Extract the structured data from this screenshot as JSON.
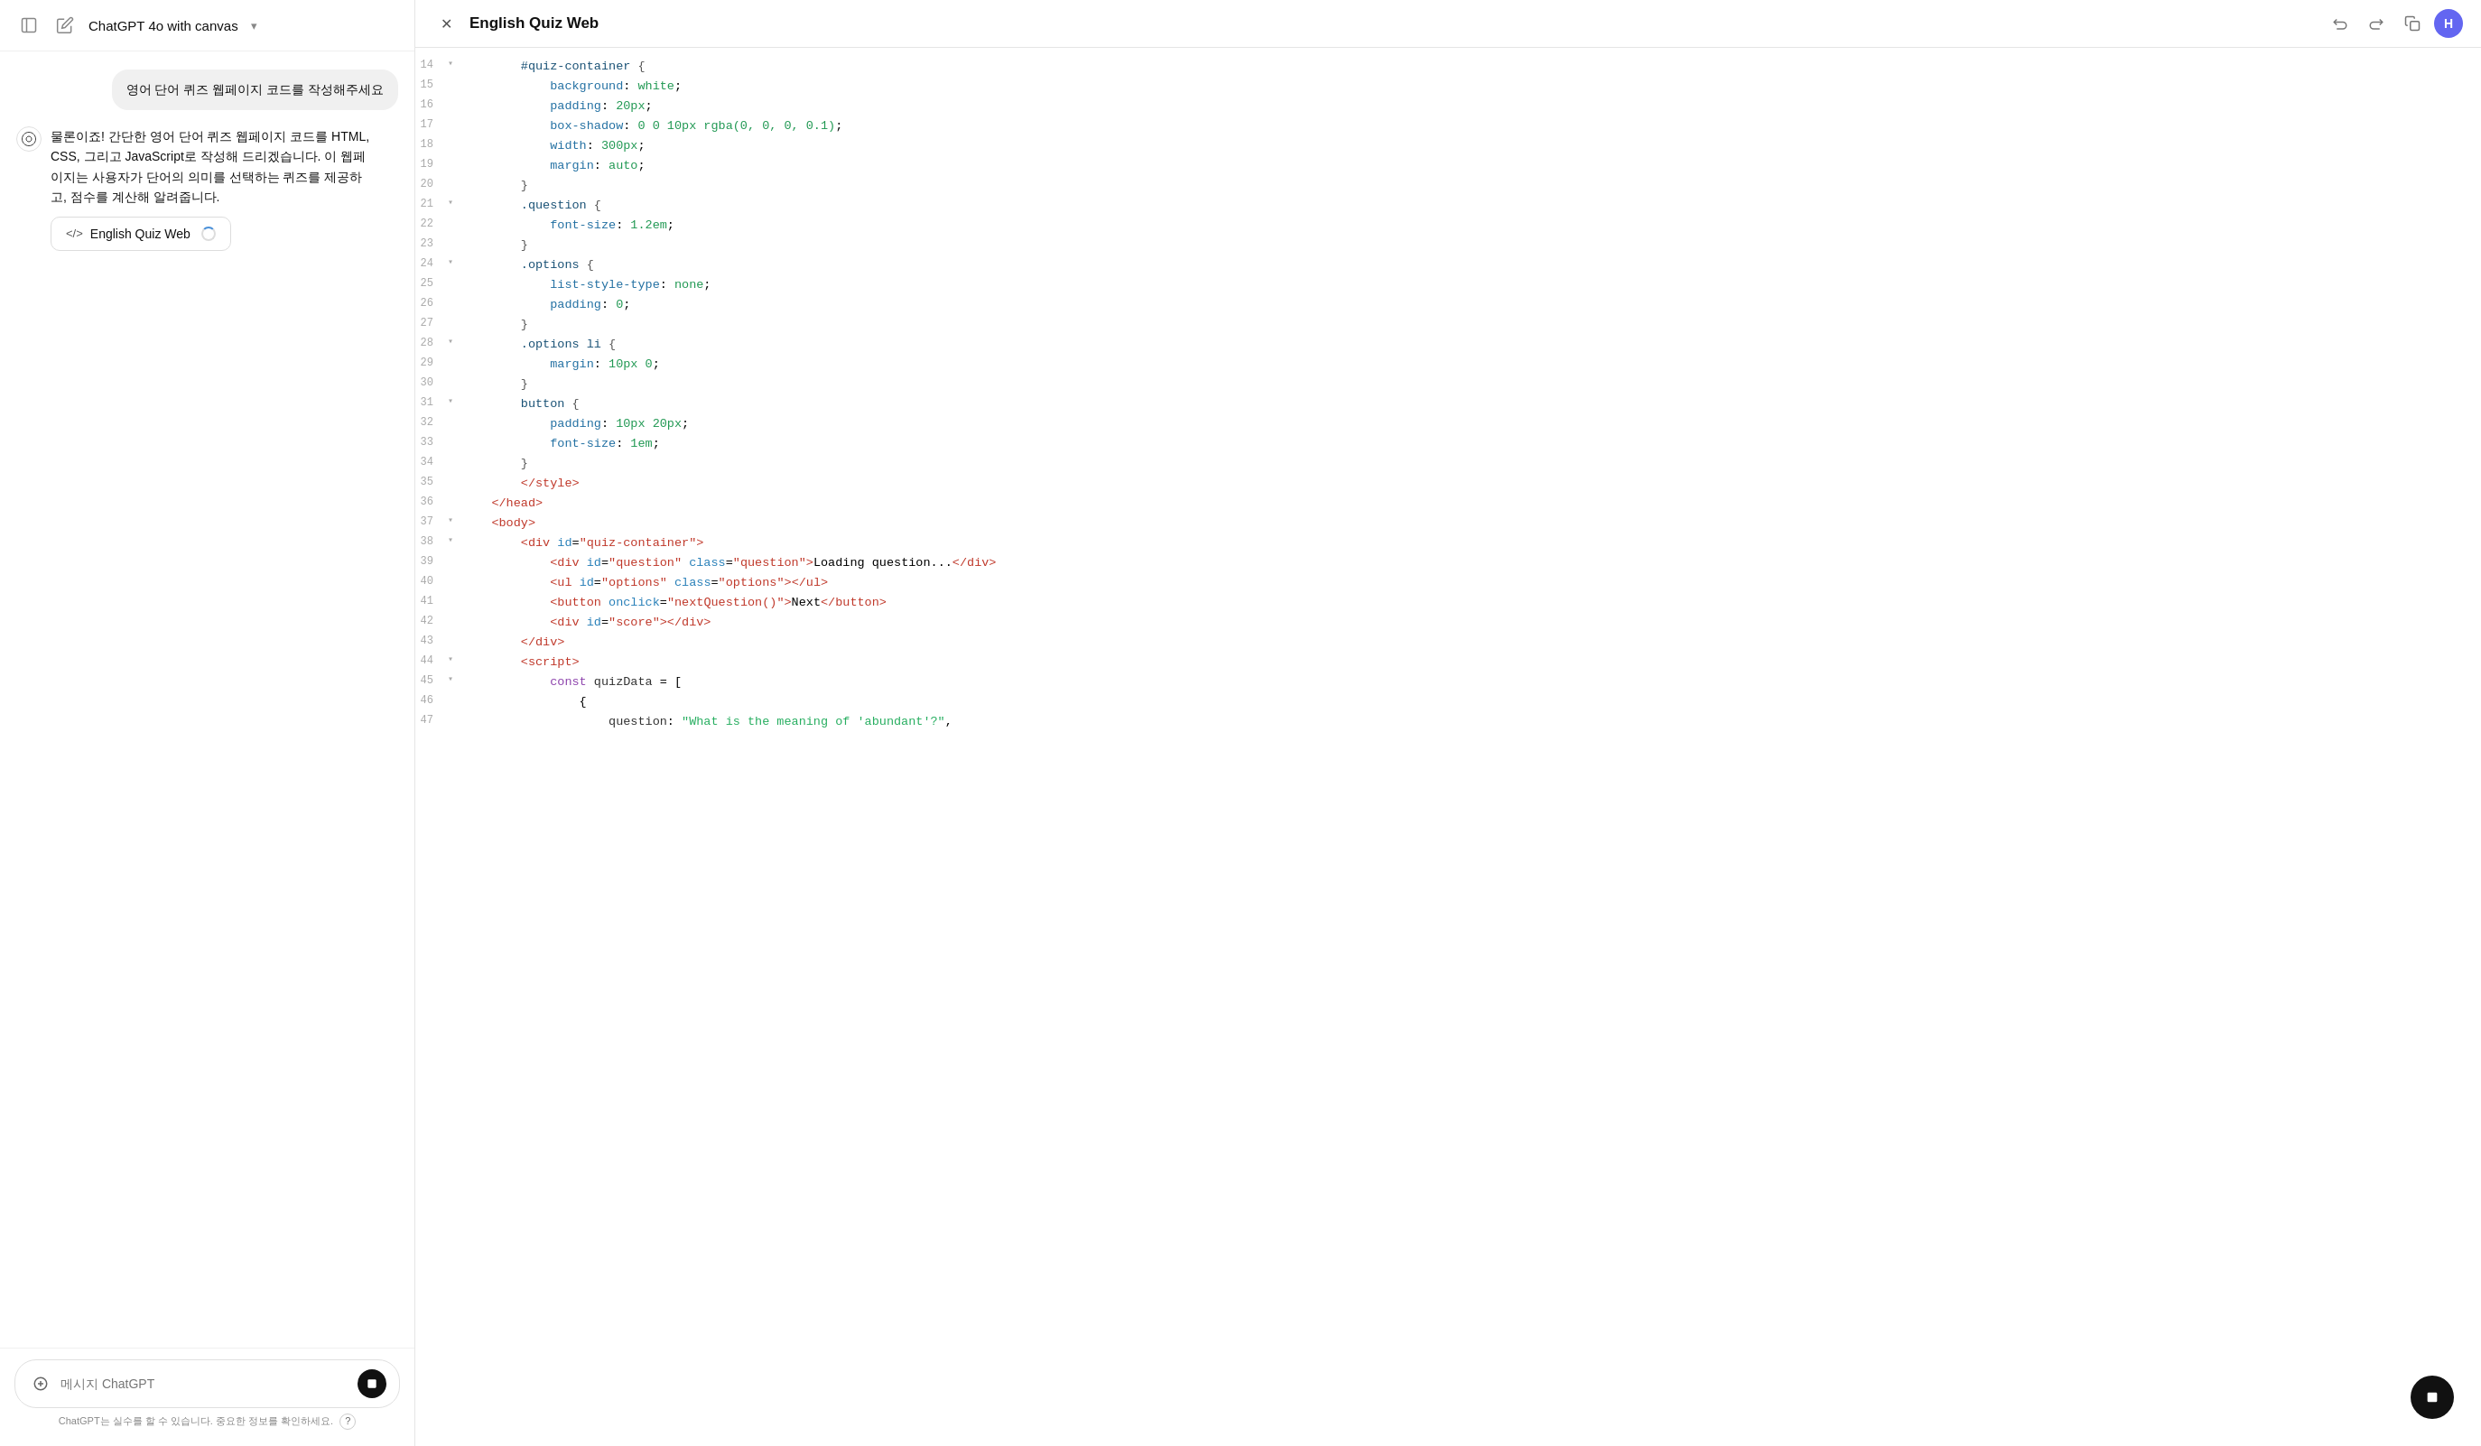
{
  "left": {
    "header": {
      "title": "ChatGPT 4o with canvas",
      "chevron": "▾"
    },
    "messages": [
      {
        "type": "user",
        "text": "영어 단어 퀴즈 웹페이지 코드를 작성해주세요"
      },
      {
        "type": "assistant",
        "text": "물론이죠! 간단한 영어 단어 퀴즈 웹페이지 코드를 HTML, CSS, 그리고 JavaScript로 작성해 드리겠습니다. 이 웹페이지는 사용자가 단어의 의미를 선택하는 퀴즈를 제공하고, 점수를 계산해 알려줍니다.",
        "canvas_button": {
          "icon": "</>",
          "label": "English Quiz Web",
          "loading": true
        }
      }
    ],
    "input": {
      "placeholder": "메시지 ChatGPT"
    },
    "disclaimer": "ChatGPT는 실수를 할 수 있습니다. 중요한 정보를 확인하세요."
  },
  "right": {
    "title": "English Quiz Web",
    "user_initial": "H",
    "code_lines": [
      {
        "num": 14,
        "fold": true,
        "indent": 2,
        "content": "#quiz-container {"
      },
      {
        "num": 15,
        "fold": false,
        "indent": 3,
        "content": "background: white;"
      },
      {
        "num": 16,
        "fold": false,
        "indent": 3,
        "content": "padding: 20px;"
      },
      {
        "num": 17,
        "fold": false,
        "indent": 3,
        "content": "box-shadow: 0 0 10px rgba(0, 0, 0, 0.1);"
      },
      {
        "num": 18,
        "fold": false,
        "indent": 3,
        "content": "width: 300px;"
      },
      {
        "num": 19,
        "fold": false,
        "indent": 3,
        "content": "margin: auto;"
      },
      {
        "num": 20,
        "fold": false,
        "indent": 2,
        "content": "}"
      },
      {
        "num": 21,
        "fold": true,
        "indent": 2,
        "content": ".question {"
      },
      {
        "num": 22,
        "fold": false,
        "indent": 3,
        "content": "font-size: 1.2em;"
      },
      {
        "num": 23,
        "fold": false,
        "indent": 2,
        "content": "}"
      },
      {
        "num": 24,
        "fold": true,
        "indent": 2,
        "content": ".options {"
      },
      {
        "num": 25,
        "fold": false,
        "indent": 3,
        "content": "list-style-type: none;"
      },
      {
        "num": 26,
        "fold": false,
        "indent": 3,
        "content": "padding: 0;"
      },
      {
        "num": 27,
        "fold": false,
        "indent": 2,
        "content": "}"
      },
      {
        "num": 28,
        "fold": true,
        "indent": 2,
        "content": ".options li {"
      },
      {
        "num": 29,
        "fold": false,
        "indent": 3,
        "content": "margin: 10px 0;"
      },
      {
        "num": 30,
        "fold": false,
        "indent": 2,
        "content": "}"
      },
      {
        "num": 31,
        "fold": true,
        "indent": 2,
        "content": "button {"
      },
      {
        "num": 32,
        "fold": false,
        "indent": 3,
        "content": "padding: 10px 20px;"
      },
      {
        "num": 33,
        "fold": false,
        "indent": 3,
        "content": "font-size: 1em;"
      },
      {
        "num": 34,
        "fold": false,
        "indent": 2,
        "content": "}"
      },
      {
        "num": 35,
        "fold": false,
        "indent": 2,
        "content": "</style>"
      },
      {
        "num": 36,
        "fold": false,
        "indent": 1,
        "content": "</head>"
      },
      {
        "num": 37,
        "fold": true,
        "indent": 1,
        "content": "<body>"
      },
      {
        "num": 38,
        "fold": true,
        "indent": 2,
        "content": "<div id=\"quiz-container\">"
      },
      {
        "num": 39,
        "fold": false,
        "indent": 3,
        "content": "<div id=\"question\" class=\"question\">Loading question...</div>"
      },
      {
        "num": 40,
        "fold": false,
        "indent": 3,
        "content": "<ul id=\"options\" class=\"options\"></ul>"
      },
      {
        "num": 41,
        "fold": false,
        "indent": 3,
        "content": "<button onclick=\"nextQuestion()\">Next</button>"
      },
      {
        "num": 42,
        "fold": false,
        "indent": 3,
        "content": "<div id=\"score\"></div>"
      },
      {
        "num": 43,
        "fold": false,
        "indent": 2,
        "content": "</div>"
      },
      {
        "num": 44,
        "fold": true,
        "indent": 2,
        "content": "<script>"
      },
      {
        "num": 45,
        "fold": true,
        "indent": 3,
        "content": "const quizData = ["
      },
      {
        "num": 46,
        "fold": false,
        "indent": 4,
        "content": "{"
      },
      {
        "num": 47,
        "fold": false,
        "indent": 5,
        "content": "question: \"What is the meaning of 'abundant'?\","
      }
    ]
  },
  "floating_stop": {
    "label": "■"
  }
}
